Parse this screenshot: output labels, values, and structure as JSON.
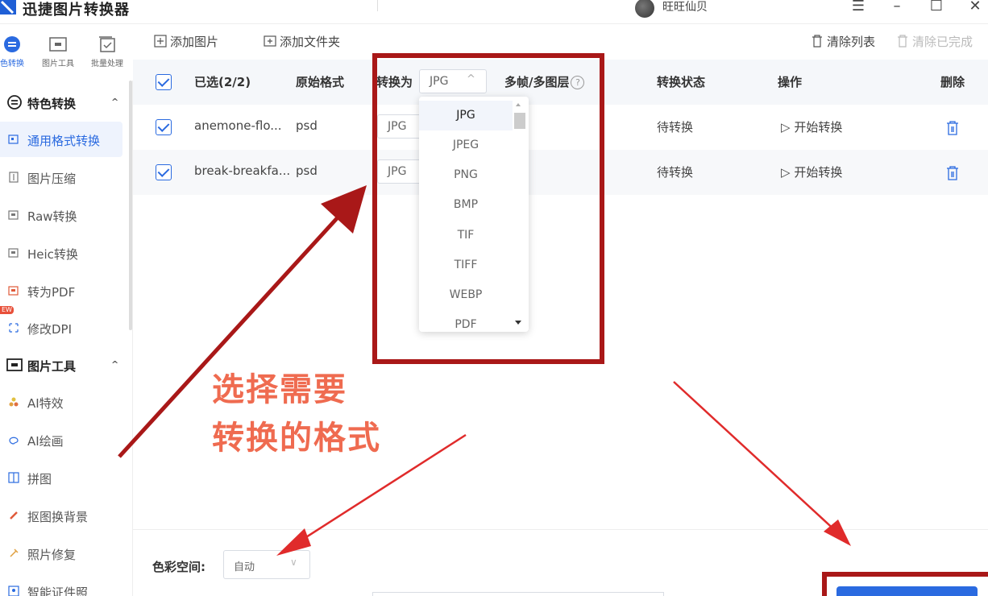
{
  "titlebar": {
    "title": "迅捷图片转换器",
    "username": "旺旺仙贝",
    "buttons": [
      "menu-icon",
      "minimize-icon",
      "maximize-icon",
      "close-icon"
    ]
  },
  "topnav": [
    {
      "label": "色转换",
      "icon": "feature-convert-icon",
      "active": true
    },
    {
      "label": "图片工具",
      "icon": "image-tools-icon",
      "active": false
    },
    {
      "label": "批量处理",
      "icon": "batch-process-icon",
      "active": false
    }
  ],
  "sidebar": {
    "groups": [
      {
        "label": "特色转换",
        "icon": "feature-convert-icon",
        "expanded": true
      },
      {
        "label": "图片工具",
        "icon": "image-tools-icon",
        "expanded": true
      }
    ],
    "items": [
      {
        "label": "通用格式转换",
        "active": true
      },
      {
        "label": "图片压缩",
        "active": false
      },
      {
        "label": "Raw转换",
        "active": false
      },
      {
        "label": "Heic转换",
        "active": false
      },
      {
        "label": "转为PDF",
        "active": false
      },
      {
        "label": "修改DPI",
        "active": false
      },
      {
        "label": "AI特效",
        "active": false
      },
      {
        "label": "AI绘画",
        "active": false
      },
      {
        "label": "拼图",
        "active": false
      },
      {
        "label": "抠图换背景",
        "active": false
      },
      {
        "label": "照片修复",
        "active": false
      },
      {
        "label": "智能证件照",
        "active": false
      }
    ],
    "new_badge": "EW"
  },
  "toolbar": {
    "add_image": "添加图片",
    "add_folder": "添加文件夹",
    "clear_list": "清除列表",
    "clear_done": "清除已完成"
  },
  "table": {
    "headers": {
      "selected": "已选(2/2)",
      "original_format": "原始格式",
      "convert_to": "转换为",
      "convert_to_value": "JPG",
      "multiframe": "多帧/多图层",
      "help": "?",
      "status": "转换状态",
      "action": "操作",
      "delete": "删除"
    },
    "rows": [
      {
        "name": "anemone-flo...",
        "format": "psd",
        "target": "JPG",
        "status": "待转换",
        "action": "开始转换"
      },
      {
        "name": "break-breakfa...",
        "format": "psd",
        "target": "JPG",
        "status": "待转换",
        "action": "开始转换"
      }
    ]
  },
  "dropdown": {
    "options": [
      "JPG",
      "JPEG",
      "PNG",
      "BMP",
      "TIF",
      "TIFF",
      "WEBP",
      "PDF"
    ],
    "selected": "JPG"
  },
  "bottombar": {
    "color_space_label": "色彩空间:",
    "color_space_value": "自动"
  },
  "annotation": {
    "line1": "选择需要",
    "line2": "转换的格式",
    "color": "#a91818"
  }
}
